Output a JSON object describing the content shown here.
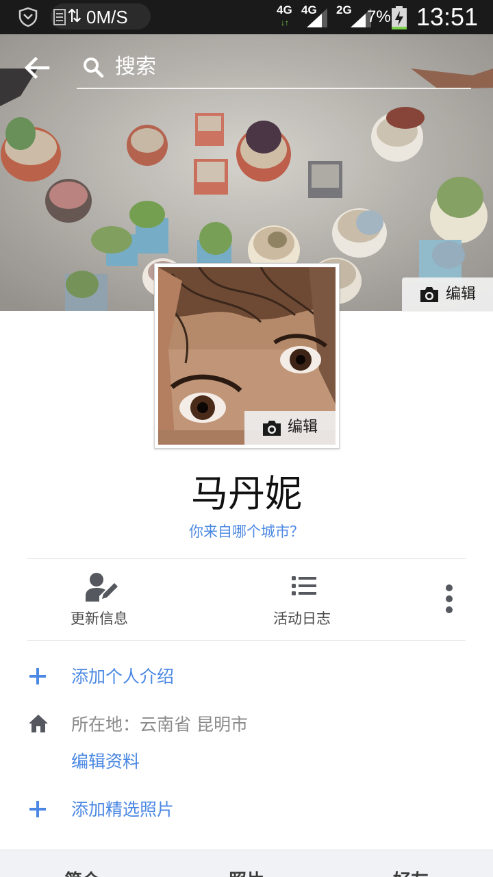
{
  "status_bar": {
    "net_speed": "0M/S",
    "net_arrows": "⇅",
    "signals": [
      {
        "label": "4G",
        "sub": "↓↑"
      },
      {
        "label": "4G",
        "sub": ""
      },
      {
        "label": "2G",
        "sub": ""
      }
    ],
    "battery": "7%",
    "time": "13:51"
  },
  "cover": {
    "search_placeholder": "搜索",
    "edit_label": "编辑"
  },
  "avatar": {
    "edit_label": "编辑"
  },
  "profile": {
    "name": "马丹妮",
    "city_prompt": "你来自哪个城市？"
  },
  "actions": {
    "update_info": "更新信息",
    "activity_log": "活动日志"
  },
  "info": {
    "add_intro": "添加个人介绍",
    "location_label": "所在地：",
    "location_value": "云南省 昆明市",
    "edit_profile": "编辑资料",
    "add_featured_photos": "添加精选照片"
  },
  "tabs": [
    "简介",
    "照片",
    "好友"
  ],
  "colors": {
    "link": "#4b88e3",
    "status_bar": "#1a1a1a",
    "icon_gray": "#55585e"
  }
}
